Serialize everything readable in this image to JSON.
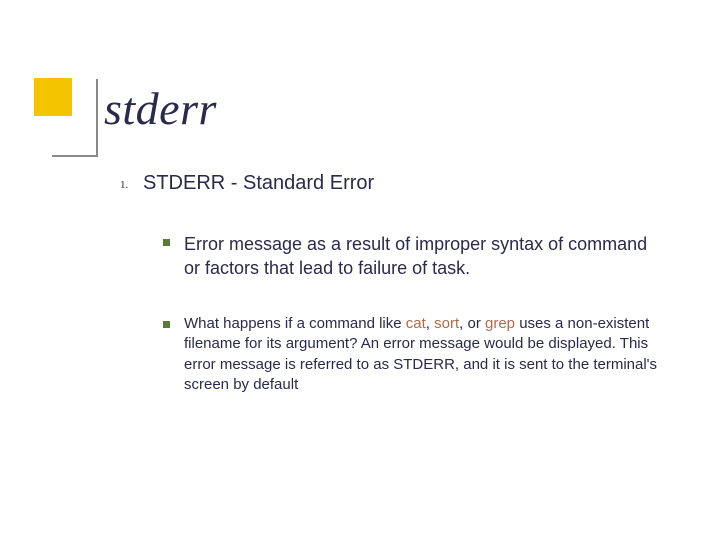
{
  "title": "stderr",
  "list_marker": "1.",
  "subheading": "STDERR - Standard Error",
  "bullet1": "Error message as a result of improper syntax of command or factors that lead to failure of task.",
  "bullet2_a": "What happens if a command like ",
  "cmd1": "cat",
  "sep12": ", ",
  "cmd2": "sort",
  "sep23": ", or ",
  "cmd3": "grep",
  "bullet2_b": " uses a non-existent filename for its argument? An error message would be displayed. This error message is referred to as STDERR, and it is sent to the terminal's screen by default"
}
